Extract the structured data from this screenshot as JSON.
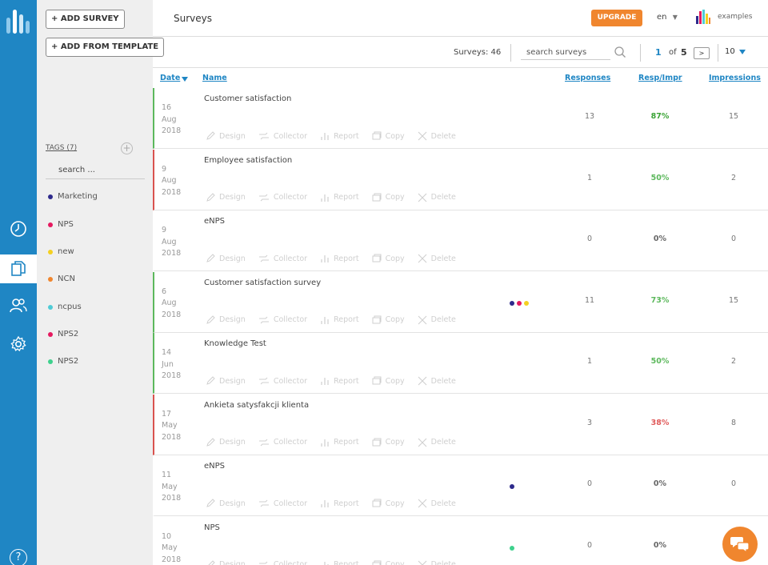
{
  "header": {
    "title": "Surveys",
    "upgrade_label": "UPGRADE",
    "language": "en",
    "examples_label": "examples"
  },
  "sidebar": {
    "add_survey_label": "+ ADD SURVEY",
    "add_template_label": "+ ADD FROM TEMPLATE",
    "tags_label": "TAGS (7)",
    "tag_search_placeholder": "search ...",
    "tags": [
      {
        "label": "Marketing",
        "color": "#2e2a8c"
      },
      {
        "label": "NPS",
        "color": "#e5195f"
      },
      {
        "label": "new",
        "color": "#f4d020"
      },
      {
        "label": "NCN",
        "color": "#f0862e"
      },
      {
        "label": "ncpus",
        "color": "#4fcbd6"
      },
      {
        "label": "NPS2",
        "color": "#e5195f"
      },
      {
        "label": "NPS2",
        "color": "#3ed18d"
      }
    ]
  },
  "rail": {
    "nav": [
      {
        "icon": "stopwatch-icon"
      },
      {
        "icon": "documents-icon"
      },
      {
        "icon": "users-icon"
      },
      {
        "icon": "gear-icon"
      }
    ],
    "help_label": "?"
  },
  "toolbar": {
    "count_label": "Surveys: 46",
    "search_placeholder": "search surveys",
    "page_current": "1",
    "page_of": "of",
    "page_total": "5",
    "next_label": ">",
    "per_page": "10"
  },
  "columns": {
    "date": "Date",
    "name": "Name",
    "responses": "Responses",
    "resp_impr": "Resp/Impr",
    "impressions": "Impressions"
  },
  "actions": {
    "design": "Design",
    "collector": "Collector",
    "report": "Report",
    "copy": "Copy",
    "delete": "Delete"
  },
  "surveys": [
    {
      "day": "16",
      "month": "Aug",
      "year": "2018",
      "name": "Customer satisfaction",
      "responses": "13",
      "rate": "87%",
      "rate_color": "#3aa335",
      "impressions": "15",
      "status_color": "#5cb85c",
      "tag_colors": []
    },
    {
      "day": "9",
      "month": "Aug",
      "year": "2018",
      "name": "Employee satisfaction",
      "responses": "1",
      "rate": "50%",
      "rate_color": "#5cb85c",
      "impressions": "2",
      "status_color": "#d9534f",
      "tag_colors": []
    },
    {
      "day": "9",
      "month": "Aug",
      "year": "2018",
      "name": "eNPS",
      "responses": "0",
      "rate": "0%",
      "rate_color": "#666666",
      "impressions": "0",
      "status_color": "",
      "tag_colors": []
    },
    {
      "day": "6",
      "month": "Aug",
      "year": "2018",
      "name": "Customer satisfaction survey",
      "responses": "11",
      "rate": "73%",
      "rate_color": "#5cb85c",
      "impressions": "15",
      "status_color": "#5cb85c",
      "tag_colors": [
        "#2e2a8c",
        "#e5195f",
        "#f4d020"
      ]
    },
    {
      "day": "14",
      "month": "Jun",
      "year": "2018",
      "name": "Knowledge Test",
      "responses": "1",
      "rate": "50%",
      "rate_color": "#5cb85c",
      "impressions": "2",
      "status_color": "#5cb85c",
      "tag_colors": []
    },
    {
      "day": "17",
      "month": "May",
      "year": "2018",
      "name": "Ankieta satysfakcji klienta",
      "responses": "3",
      "rate": "38%",
      "rate_color": "#e05a5a",
      "impressions": "8",
      "status_color": "#d9534f",
      "tag_colors": []
    },
    {
      "day": "11",
      "month": "May",
      "year": "2018",
      "name": "eNPS",
      "responses": "0",
      "rate": "0%",
      "rate_color": "#666666",
      "impressions": "0",
      "status_color": "",
      "tag_colors": [
        "#2e2a8c"
      ]
    },
    {
      "day": "10",
      "month": "May",
      "year": "2018",
      "name": "NPS",
      "responses": "0",
      "rate": "0%",
      "rate_color": "#666666",
      "impressions": "",
      "status_color": "",
      "tag_colors": [
        "#3ed18d"
      ]
    }
  ]
}
